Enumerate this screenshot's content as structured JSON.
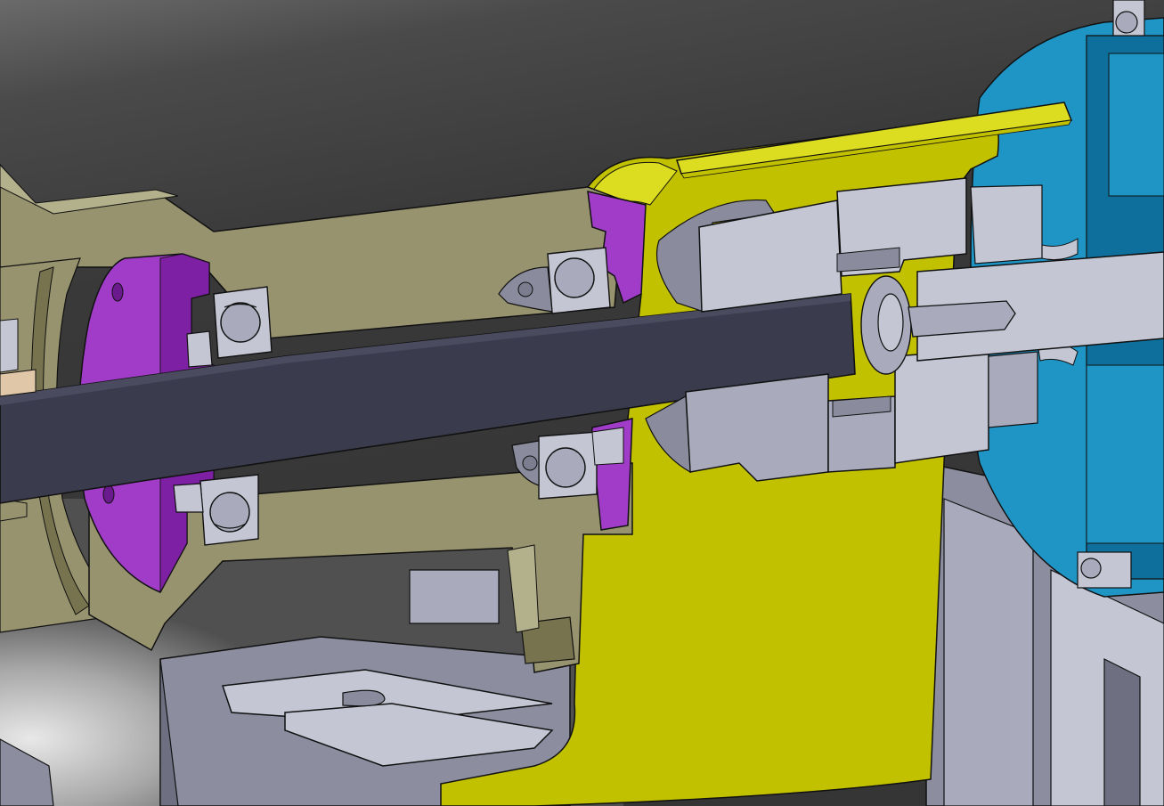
{
  "scene": {
    "description_kind": "cad-section-view",
    "colors": {
      "background_dark": "#3b3b3b",
      "background_light": "#d9d9d9",
      "housing_khaki": "#97936f",
      "housing_khaki_light": "#b3b08c",
      "housing_khaki_dark": "#77734f",
      "flange_purple": "#a03cc8",
      "flange_purple_dark": "#7a1ea0",
      "shaft_dark": "#3a3b4c",
      "coupling_yellow": "#c2c100",
      "coupling_yellow_light": "#dcdc20",
      "hub_grey": "#a9abbd",
      "hub_grey_light": "#c4c6d4",
      "hub_grey_dark": "#8a8c9e",
      "motor_blue": "#1f95c6",
      "motor_blue_dark": "#0f6f9c",
      "bracket_grey": "#8c8ea0",
      "bracket_grey_dark": "#6e7082",
      "tan": "#e0c7a8",
      "outline": "#111111"
    }
  }
}
